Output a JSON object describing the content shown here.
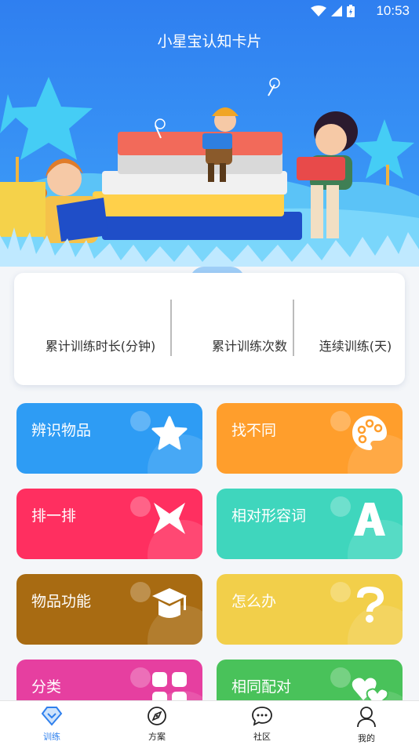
{
  "status_bar": {
    "time": "10:53"
  },
  "app": {
    "title": "小星宝认知卡片"
  },
  "stats": [
    {
      "label": "累计训练时长(分钟)"
    },
    {
      "label": "累计训练次数"
    },
    {
      "label": "连续训练(天)"
    }
  ],
  "tiles": [
    {
      "label": "辨识物品",
      "color": "#2e9cf4",
      "icon": "star-icon"
    },
    {
      "label": "找不同",
      "color": "#ff9e2c",
      "icon": "palette-icon"
    },
    {
      "label": "排一排",
      "color": "#ff2f60",
      "icon": "bowtie-icon"
    },
    {
      "label": "相对形容词",
      "color": "#3fd6bd",
      "icon": "letter-a-icon"
    },
    {
      "label": "物品功能",
      "color": "#a86b12",
      "icon": "graduation-cap-icon"
    },
    {
      "label": "怎么办",
      "color": "#f2cf4a",
      "icon": "question-mark-icon"
    },
    {
      "label": "分类",
      "color": "#e63fa0",
      "icon": "grid-icon"
    },
    {
      "label": "相同配对",
      "color": "#49c25a",
      "icon": "hearts-icon"
    }
  ],
  "tabbar": [
    {
      "label": "训练",
      "icon": "diamond-heart-icon",
      "active": true
    },
    {
      "label": "方案",
      "icon": "compass-icon",
      "active": false
    },
    {
      "label": "社区",
      "icon": "chat-bubble-icon",
      "active": false
    },
    {
      "label": "我的",
      "icon": "person-icon",
      "active": false
    }
  ]
}
